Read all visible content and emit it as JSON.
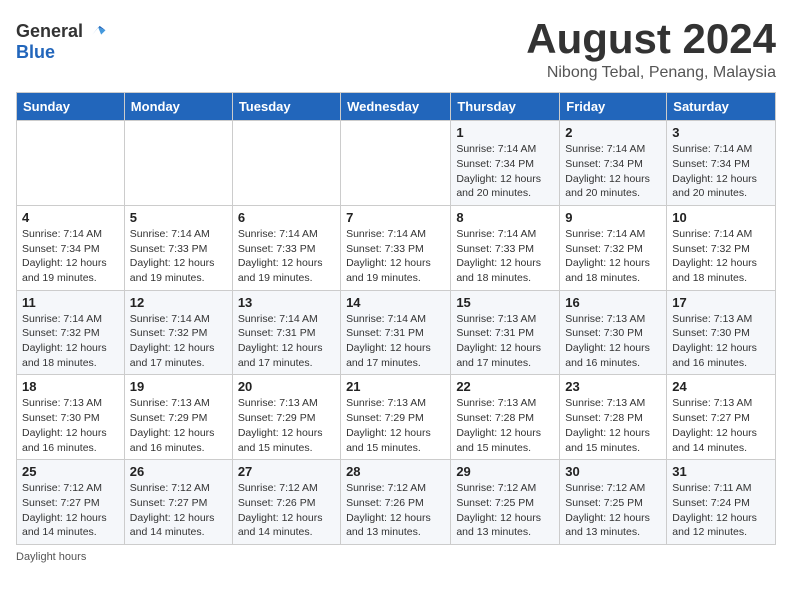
{
  "header": {
    "logo_general": "General",
    "logo_blue": "Blue",
    "month_year": "August 2024",
    "location": "Nibong Tebal, Penang, Malaysia"
  },
  "weekdays": [
    "Sunday",
    "Monday",
    "Tuesday",
    "Wednesday",
    "Thursday",
    "Friday",
    "Saturday"
  ],
  "weeks": [
    [
      {
        "day": "",
        "info": ""
      },
      {
        "day": "",
        "info": ""
      },
      {
        "day": "",
        "info": ""
      },
      {
        "day": "",
        "info": ""
      },
      {
        "day": "1",
        "info": "Sunrise: 7:14 AM\nSunset: 7:34 PM\nDaylight: 12 hours\nand 20 minutes."
      },
      {
        "day": "2",
        "info": "Sunrise: 7:14 AM\nSunset: 7:34 PM\nDaylight: 12 hours\nand 20 minutes."
      },
      {
        "day": "3",
        "info": "Sunrise: 7:14 AM\nSunset: 7:34 PM\nDaylight: 12 hours\nand 20 minutes."
      }
    ],
    [
      {
        "day": "4",
        "info": "Sunrise: 7:14 AM\nSunset: 7:34 PM\nDaylight: 12 hours\nand 19 minutes."
      },
      {
        "day": "5",
        "info": "Sunrise: 7:14 AM\nSunset: 7:33 PM\nDaylight: 12 hours\nand 19 minutes."
      },
      {
        "day": "6",
        "info": "Sunrise: 7:14 AM\nSunset: 7:33 PM\nDaylight: 12 hours\nand 19 minutes."
      },
      {
        "day": "7",
        "info": "Sunrise: 7:14 AM\nSunset: 7:33 PM\nDaylight: 12 hours\nand 19 minutes."
      },
      {
        "day": "8",
        "info": "Sunrise: 7:14 AM\nSunset: 7:33 PM\nDaylight: 12 hours\nand 18 minutes."
      },
      {
        "day": "9",
        "info": "Sunrise: 7:14 AM\nSunset: 7:32 PM\nDaylight: 12 hours\nand 18 minutes."
      },
      {
        "day": "10",
        "info": "Sunrise: 7:14 AM\nSunset: 7:32 PM\nDaylight: 12 hours\nand 18 minutes."
      }
    ],
    [
      {
        "day": "11",
        "info": "Sunrise: 7:14 AM\nSunset: 7:32 PM\nDaylight: 12 hours\nand 18 minutes."
      },
      {
        "day": "12",
        "info": "Sunrise: 7:14 AM\nSunset: 7:32 PM\nDaylight: 12 hours\nand 17 minutes."
      },
      {
        "day": "13",
        "info": "Sunrise: 7:14 AM\nSunset: 7:31 PM\nDaylight: 12 hours\nand 17 minutes."
      },
      {
        "day": "14",
        "info": "Sunrise: 7:14 AM\nSunset: 7:31 PM\nDaylight: 12 hours\nand 17 minutes."
      },
      {
        "day": "15",
        "info": "Sunrise: 7:13 AM\nSunset: 7:31 PM\nDaylight: 12 hours\nand 17 minutes."
      },
      {
        "day": "16",
        "info": "Sunrise: 7:13 AM\nSunset: 7:30 PM\nDaylight: 12 hours\nand 16 minutes."
      },
      {
        "day": "17",
        "info": "Sunrise: 7:13 AM\nSunset: 7:30 PM\nDaylight: 12 hours\nand 16 minutes."
      }
    ],
    [
      {
        "day": "18",
        "info": "Sunrise: 7:13 AM\nSunset: 7:30 PM\nDaylight: 12 hours\nand 16 minutes."
      },
      {
        "day": "19",
        "info": "Sunrise: 7:13 AM\nSunset: 7:29 PM\nDaylight: 12 hours\nand 16 minutes."
      },
      {
        "day": "20",
        "info": "Sunrise: 7:13 AM\nSunset: 7:29 PM\nDaylight: 12 hours\nand 15 minutes."
      },
      {
        "day": "21",
        "info": "Sunrise: 7:13 AM\nSunset: 7:29 PM\nDaylight: 12 hours\nand 15 minutes."
      },
      {
        "day": "22",
        "info": "Sunrise: 7:13 AM\nSunset: 7:28 PM\nDaylight: 12 hours\nand 15 minutes."
      },
      {
        "day": "23",
        "info": "Sunrise: 7:13 AM\nSunset: 7:28 PM\nDaylight: 12 hours\nand 15 minutes."
      },
      {
        "day": "24",
        "info": "Sunrise: 7:13 AM\nSunset: 7:27 PM\nDaylight: 12 hours\nand 14 minutes."
      }
    ],
    [
      {
        "day": "25",
        "info": "Sunrise: 7:12 AM\nSunset: 7:27 PM\nDaylight: 12 hours\nand 14 minutes."
      },
      {
        "day": "26",
        "info": "Sunrise: 7:12 AM\nSunset: 7:27 PM\nDaylight: 12 hours\nand 14 minutes."
      },
      {
        "day": "27",
        "info": "Sunrise: 7:12 AM\nSunset: 7:26 PM\nDaylight: 12 hours\nand 14 minutes."
      },
      {
        "day": "28",
        "info": "Sunrise: 7:12 AM\nSunset: 7:26 PM\nDaylight: 12 hours\nand 13 minutes."
      },
      {
        "day": "29",
        "info": "Sunrise: 7:12 AM\nSunset: 7:25 PM\nDaylight: 12 hours\nand 13 minutes."
      },
      {
        "day": "30",
        "info": "Sunrise: 7:12 AM\nSunset: 7:25 PM\nDaylight: 12 hours\nand 13 minutes."
      },
      {
        "day": "31",
        "info": "Sunrise: 7:11 AM\nSunset: 7:24 PM\nDaylight: 12 hours\nand 12 minutes."
      }
    ]
  ],
  "footer": {
    "daylight_hours": "Daylight hours"
  }
}
